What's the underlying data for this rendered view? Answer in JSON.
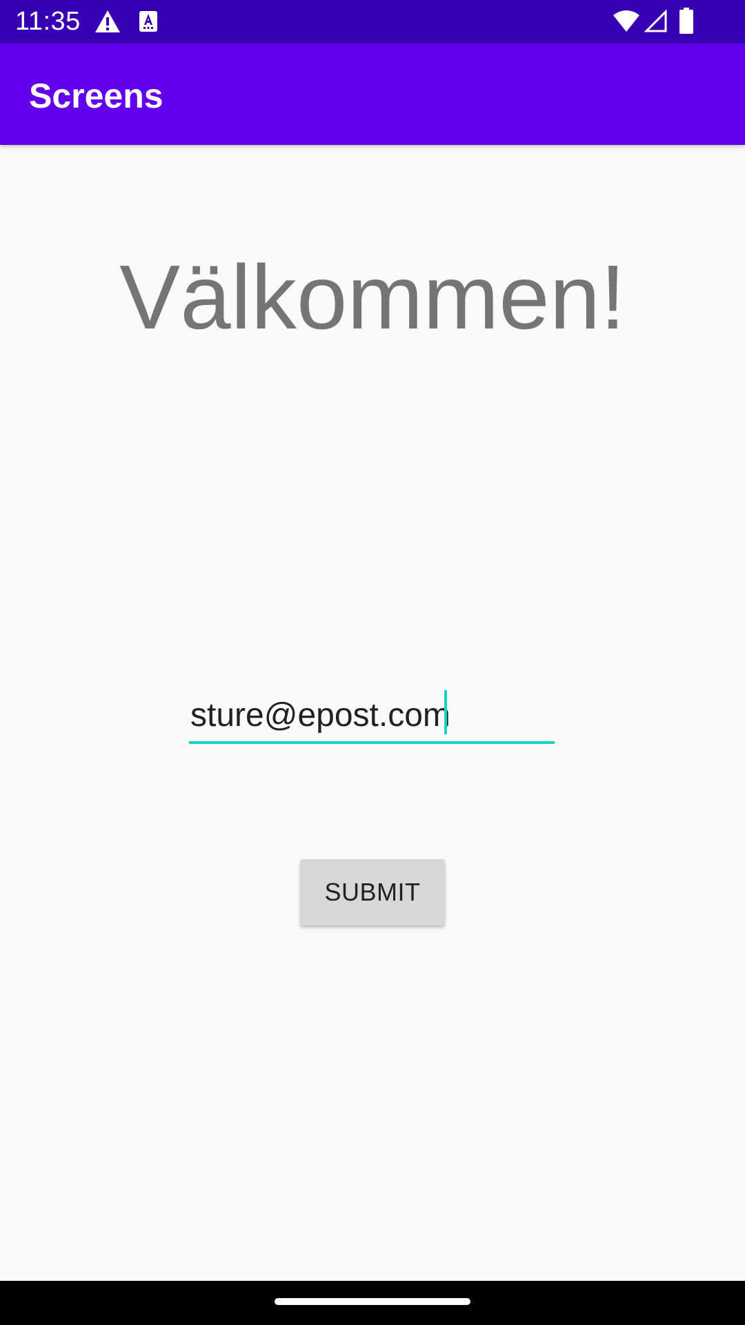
{
  "status_bar": {
    "time": "11:35",
    "icons": [
      "warning-icon",
      "a-notification-icon",
      "wifi-icon",
      "signal-icon",
      "battery-icon"
    ],
    "background": "#3700b3"
  },
  "app_bar": {
    "title": "Screens",
    "background": "#6200ee"
  },
  "main": {
    "welcome_text": "Välkommen!",
    "email_field": {
      "value": "sture@epost.com",
      "accent_color": "#18d3c4"
    },
    "submit_label": "SUBMIT"
  },
  "nav_bar": {
    "icons": [
      "home-handle"
    ]
  }
}
